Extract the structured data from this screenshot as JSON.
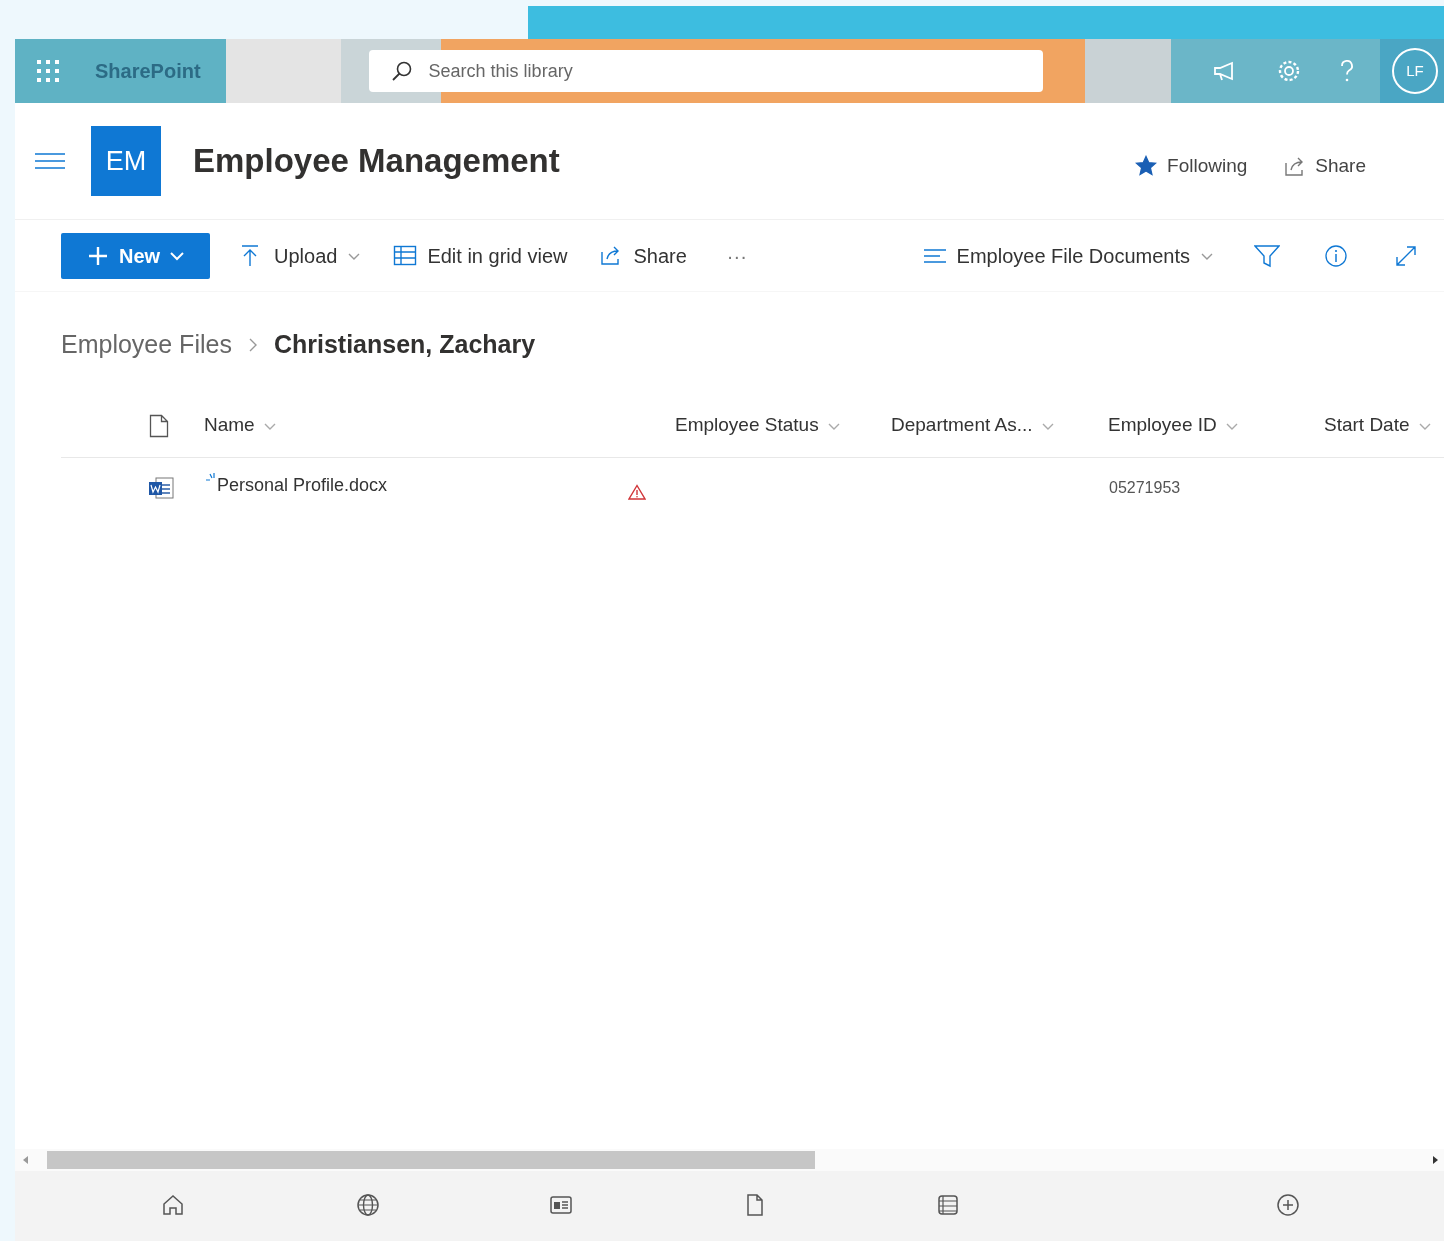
{
  "suite_bar": {
    "app_name": "SharePoint",
    "search": {
      "placeholder": "Search this library"
    },
    "avatar": "LF"
  },
  "site": {
    "logo": "EM",
    "title": "Employee Management",
    "following": {
      "label": "Following",
      "on": true
    },
    "share": "Share"
  },
  "command_bar": [
    {
      "kind": "new",
      "label": "New"
    },
    {
      "kind": "upload",
      "label": "Upload"
    },
    {
      "kind": "grid",
      "label": "Edit in grid view"
    },
    {
      "kind": "share",
      "label": "Share"
    },
    {
      "kind": "more",
      "label": "···"
    }
  ],
  "view": {
    "label": "Employee File Documents"
  },
  "breadcrumb": [
    "Employee Files",
    "Christiansen, Zachary"
  ],
  "table": {
    "columns": [
      "Name",
      "Employee Status",
      "Department As...",
      "Employee ID",
      "Start Date"
    ],
    "rows": [
      {
        "name": "Personal Profile.docx",
        "is_new": true,
        "warning": true,
        "employee_id": "05271953"
      }
    ]
  }
}
